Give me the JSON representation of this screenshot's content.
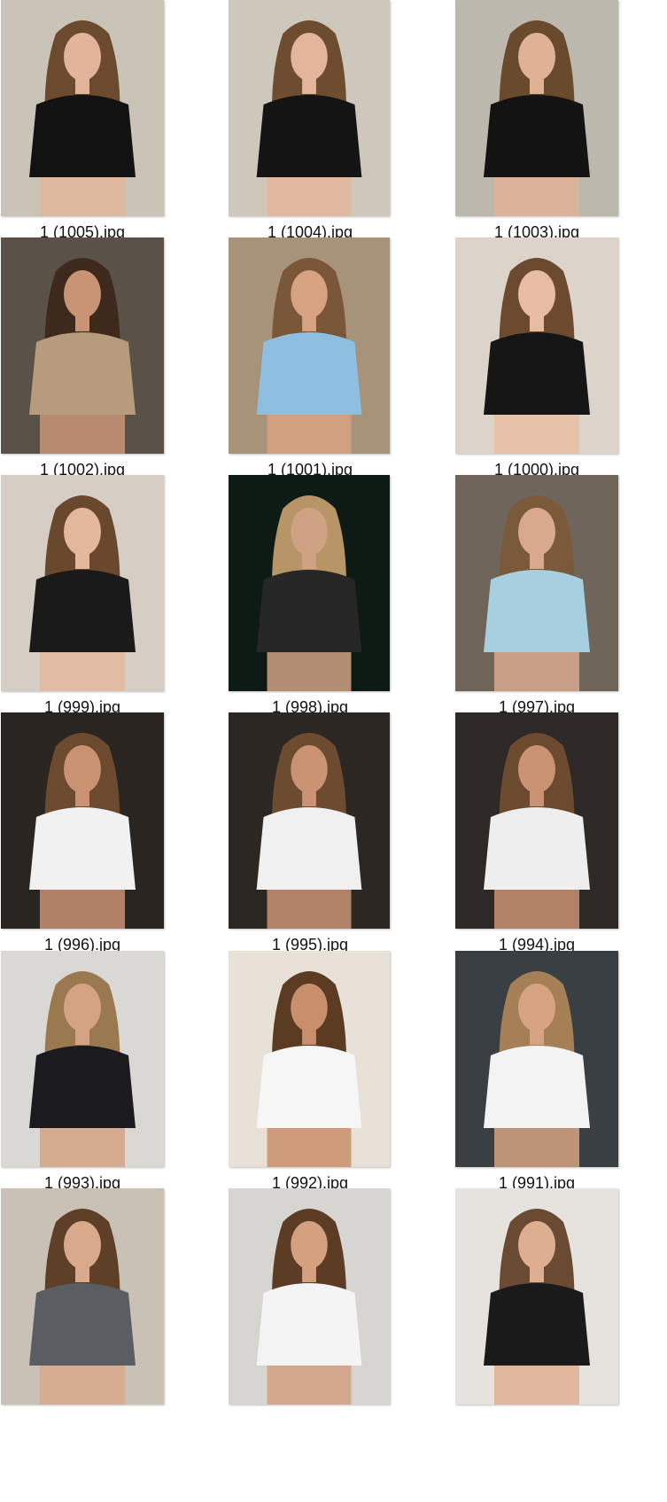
{
  "files": [
    {
      "name": "1 (1005).jpg",
      "bg": "#c9c3b8",
      "hair": "#6b4a2e",
      "top": "#121212",
      "skin": "#e2b59a"
    },
    {
      "name": "1 (1004).jpg",
      "bg": "#cdc7bc",
      "hair": "#6e4c2f",
      "top": "#141414",
      "skin": "#e3b69b"
    },
    {
      "name": "1 (1003).jpg",
      "bg": "#bdb8ae",
      "hair": "#6a4a2d",
      "top": "#131313",
      "skin": "#dfb296"
    },
    {
      "name": "1 (1002).jpg",
      "bg": "#5a5149",
      "hair": "#3d2a1c",
      "top": "#b79b7d",
      "skin": "#c99476"
    },
    {
      "name": "1 (1001).jpg",
      "bg": "#a7937a",
      "hair": "#7a5738",
      "top": "#8fbfe0",
      "skin": "#d7a282"
    },
    {
      "name": "1 (1000).jpg",
      "bg": "#dcd3cb",
      "hair": "#6c4a30",
      "top": "#151515",
      "skin": "#e7bca2"
    },
    {
      "name": "1 (999).jpg",
      "bg": "#d6cdc5",
      "hair": "#6a482e",
      "top": "#1a1a1a",
      "skin": "#e4b89d"
    },
    {
      "name": "1 (998).jpg",
      "bg": "#0e1a14",
      "hair": "#b79566",
      "top": "#262626",
      "skin": "#cfa283"
    },
    {
      "name": "1 (997).jpg",
      "bg": "#6f655a",
      "hair": "#7b5a3b",
      "top": "#a7cfe0",
      "skin": "#d8a98c"
    },
    {
      "name": "1 (996).jpg",
      "bg": "#2b2522",
      "hair": "#6c4a2f",
      "top": "#f1f1f1",
      "skin": "#c99273"
    },
    {
      "name": "1 (995).jpg",
      "bg": "#2d2724",
      "hair": "#6d4b30",
      "top": "#f0f0f0",
      "skin": "#ca9374"
    },
    {
      "name": "1 (994).jpg",
      "bg": "#2e2826",
      "hair": "#6c4a2f",
      "top": "#eeeeee",
      "skin": "#c99273"
    },
    {
      "name": "1 (993).jpg",
      "bg": "#d9d8d5",
      "hair": "#9a7850",
      "top": "#1a1a1f",
      "skin": "#d4a384"
    },
    {
      "name": "1 (992).jpg",
      "bg": "#e7e1d8",
      "hair": "#5b3b22",
      "top": "#f6f6f6",
      "skin": "#c98e6b"
    },
    {
      "name": "1 (991).jpg",
      "bg": "#3a3f44",
      "hair": "#a58056",
      "top": "#f3f3f3",
      "skin": "#d6a383"
    },
    {
      "name": "",
      "bg": "#c9c1b6",
      "hair": "#5e3f27",
      "top": "#5a5d62",
      "skin": "#d9a98b"
    },
    {
      "name": "",
      "bg": "#d7d5d2",
      "hair": "#5c3c24",
      "top": "#f4f4f4",
      "skin": "#d4a080"
    },
    {
      "name": "",
      "bg": "#e6e3de",
      "hair": "#6a4a32",
      "top": "#1a1a1a",
      "skin": "#deae91"
    }
  ]
}
